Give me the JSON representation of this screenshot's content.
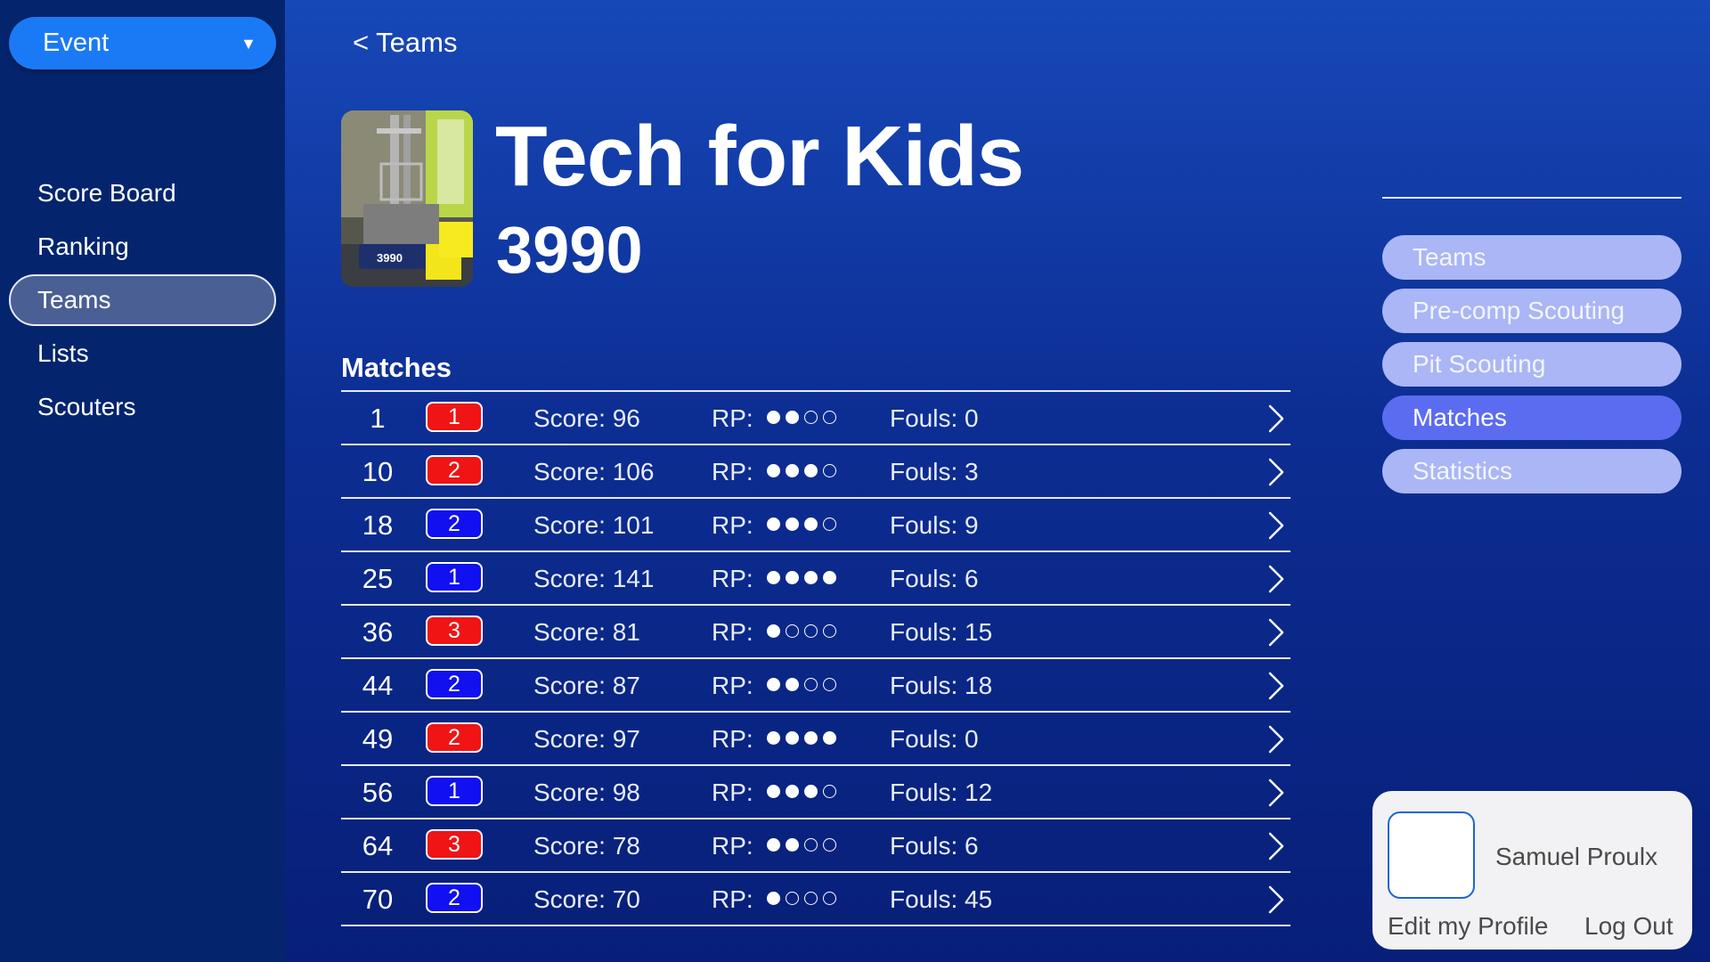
{
  "sidebar": {
    "event_label": "Event",
    "items": [
      {
        "label": "Score Board",
        "active": false
      },
      {
        "label": "Ranking",
        "active": false
      },
      {
        "label": "Teams",
        "active": true
      },
      {
        "label": "Lists",
        "active": false
      },
      {
        "label": "Scouters",
        "active": false
      }
    ]
  },
  "header": {
    "back_label": "< Teams",
    "team_name": "Tech for Kids",
    "team_number": "3990",
    "photo_caption": "3990"
  },
  "matches": {
    "title": "Matches",
    "rp_label": "RP:",
    "rows": [
      {
        "match": "1",
        "alliance": "red",
        "position": "1",
        "score": "Score: 96",
        "rp": 2,
        "fouls": "Fouls: 0"
      },
      {
        "match": "10",
        "alliance": "red",
        "position": "2",
        "score": "Score: 106",
        "rp": 3,
        "fouls": "Fouls: 3"
      },
      {
        "match": "18",
        "alliance": "blue",
        "position": "2",
        "score": "Score: 101",
        "rp": 3,
        "fouls": "Fouls: 9"
      },
      {
        "match": "25",
        "alliance": "blue",
        "position": "1",
        "score": "Score: 141",
        "rp": 4,
        "fouls": "Fouls: 6"
      },
      {
        "match": "36",
        "alliance": "red",
        "position": "3",
        "score": "Score: 81",
        "rp": 1,
        "fouls": "Fouls: 15"
      },
      {
        "match": "44",
        "alliance": "blue",
        "position": "2",
        "score": "Score: 87",
        "rp": 2,
        "fouls": "Fouls: 18"
      },
      {
        "match": "49",
        "alliance": "red",
        "position": "2",
        "score": "Score: 97",
        "rp": 4,
        "fouls": "Fouls: 0"
      },
      {
        "match": "56",
        "alliance": "blue",
        "position": "1",
        "score": "Score: 98",
        "rp": 3,
        "fouls": "Fouls: 12"
      },
      {
        "match": "64",
        "alliance": "red",
        "position": "3",
        "score": "Score: 78",
        "rp": 2,
        "fouls": "Fouls: 6"
      },
      {
        "match": "70",
        "alliance": "blue",
        "position": "2",
        "score": "Score: 70",
        "rp": 1,
        "fouls": "Fouls: 45"
      }
    ]
  },
  "right_tabs": [
    {
      "label": "Teams",
      "active": false
    },
    {
      "label": "Pre-comp Scouting",
      "active": false
    },
    {
      "label": "Pit Scouting",
      "active": false
    },
    {
      "label": "Matches",
      "active": true
    },
    {
      "label": "Statistics",
      "active": false
    }
  ],
  "profile": {
    "name": "Samuel Proulx",
    "edit_label": "Edit my Profile",
    "logout_label": "Log Out"
  },
  "colors": {
    "sidebar_bg": "#04256e",
    "event_button": "#1a7af5",
    "alliance_red": "#f01414",
    "alliance_blue": "#1010f0",
    "tab_inactive": "#aab6f5",
    "tab_active": "#5b6cf0"
  },
  "icons": {
    "event_dropdown": "chevron-down-icon",
    "row_chevron": "chevron-right-icon",
    "rp_full": "filled-circle",
    "rp_empty": "hollow-circle"
  }
}
